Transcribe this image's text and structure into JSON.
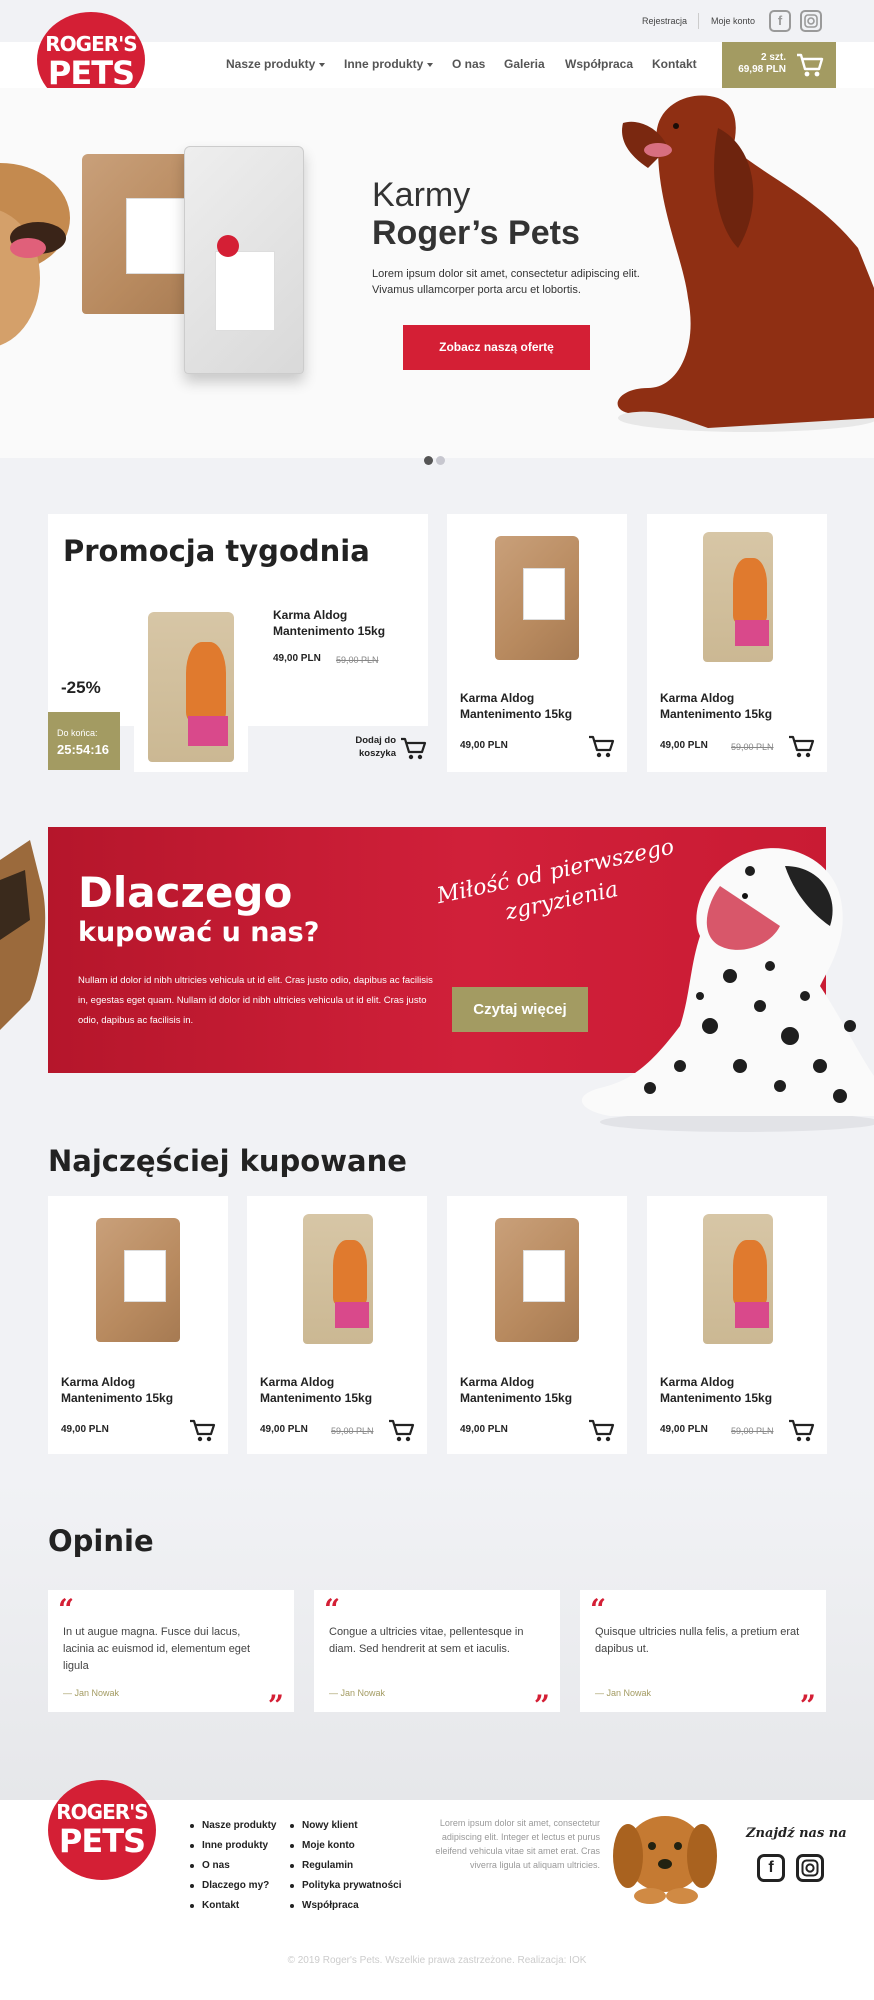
{
  "header": {
    "register": "Rejestracja",
    "account": "Moje konto",
    "nav": [
      "Nasze produkty",
      "Inne produkty",
      "O nas",
      "Galeria",
      "Współpraca",
      "Kontakt"
    ],
    "cart": {
      "qty": "2 szt.",
      "total": "69,98 PLN"
    }
  },
  "logo": {
    "line1": "ROGER'S",
    "line2": "PETS"
  },
  "hero": {
    "title_light": "Karmy",
    "title_bold": "Roger’s Pets",
    "text": "Lorem ipsum dolor sit amet, consectetur adipiscing elit. Vivamus ullamcorper porta arcu et lobortis.",
    "cta": "Zobacz naszą ofertę"
  },
  "promo": {
    "title": "Promocja tygodnia",
    "name": "Karma Aldog Mantenimento 15kg",
    "price": "49,00 PLN",
    "old_price": "59,00 PLN",
    "discount": "-25%",
    "countdown_label": "Do końca:",
    "countdown": "25:54:16",
    "add_to_cart": "Dodaj do koszyka"
  },
  "promo_side": [
    {
      "name": "Karma Aldog Mantenimento 15kg",
      "price": "49,00 PLN",
      "old": ""
    },
    {
      "name": "Karma Aldog Mantenimento 15kg",
      "price": "49,00 PLN",
      "old": "59,00 PLN"
    }
  ],
  "why": {
    "title": "Dlaczego",
    "subtitle": "kupować u nas?",
    "text": "Nullam id dolor id nibh ultricies vehicula ut id elit. Cras justo odio, dapibus ac facilisis in, egestas eget quam. Nullam id dolor id nibh ultricies vehicula ut id elit. Cras justo odio, dapibus ac facilisis in.",
    "tagline1": "Miłość od pierwszego",
    "tagline2": "zgryzienia",
    "cta": "Czytaj więcej"
  },
  "bestsellers": {
    "title": "Najczęściej kupowane",
    "items": [
      {
        "name": "Karma Aldog Mantenimento 15kg",
        "price": "49,00 PLN",
        "old": ""
      },
      {
        "name": "Karma Aldog Mantenimento 15kg",
        "price": "49,00 PLN",
        "old": "59,00 PLN"
      },
      {
        "name": "Karma Aldog Mantenimento 15kg",
        "price": "49,00 PLN",
        "old": ""
      },
      {
        "name": "Karma Aldog Mantenimento 15kg",
        "price": "49,00 PLN",
        "old": "59,00 PLN"
      }
    ]
  },
  "reviews": {
    "title": "Opinie",
    "items": [
      {
        "text": "In ut augue magna. Fusce dui lacus, lacinia ac euismod id, elementum eget ligula",
        "author": "— Jan Nowak"
      },
      {
        "text": "Congue a ultricies vitae, pellentesque in diam. Sed hendrerit at sem et iaculis.",
        "author": "— Jan Nowak"
      },
      {
        "text": "Quisque ultricies nulla felis, a pretium erat dapibus ut.",
        "author": "— Jan Nowak"
      }
    ]
  },
  "footer": {
    "col1": [
      "Nasze produkty",
      "Inne produkty",
      "O nas",
      "Dlaczego my?",
      "Kontakt"
    ],
    "col2": [
      "Nowy klient",
      "Moje konto",
      "Regulamin",
      "Polityka prywatności",
      "Współpraca"
    ],
    "text": "Lorem ipsum dolor sit amet, consectetur adipiscing elit. Integer et lectus et purus eleifend vehicula vitae sit amet erat. Cras viverra ligula ut aliquam ultricies.",
    "find_us": "Znajdź nas na",
    "copyright": "© 2019 Roger's Pets. Wszelkie prawa zastrzeżone. Realizacja: IOK"
  },
  "colors": {
    "accent_red": "#d41f35",
    "olive": "#a39b62",
    "bg": "#f1f2f5"
  }
}
